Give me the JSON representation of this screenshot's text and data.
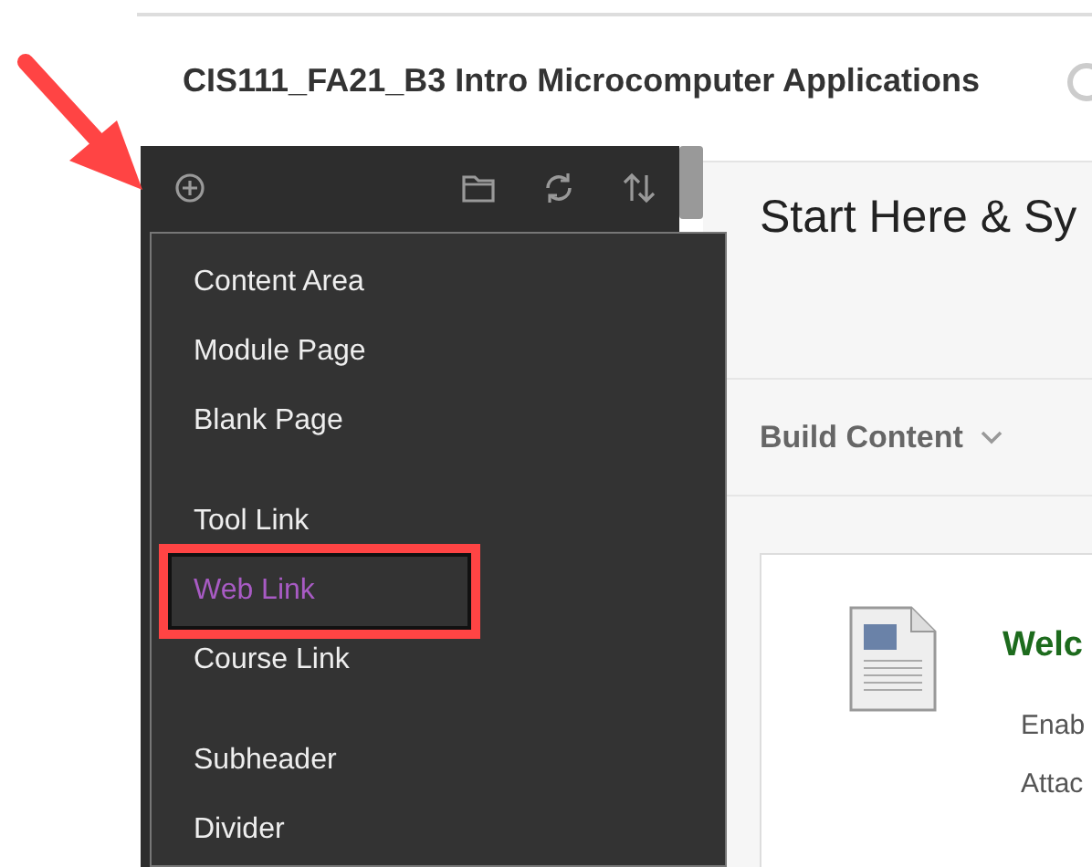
{
  "course_title": "CIS111_FA21_B3 Intro Microcomputer Applications",
  "menu": {
    "groups": [
      [
        {
          "label": "Content Area",
          "selected": false,
          "highlighted": false
        },
        {
          "label": "Module Page",
          "selected": false,
          "highlighted": false
        },
        {
          "label": "Blank Page",
          "selected": false,
          "highlighted": false
        }
      ],
      [
        {
          "label": "Tool Link",
          "selected": false,
          "highlighted": false
        },
        {
          "label": "Web Link",
          "selected": true,
          "highlighted": true
        },
        {
          "label": "Course Link",
          "selected": false,
          "highlighted": false
        }
      ],
      [
        {
          "label": "Subheader",
          "selected": false,
          "highlighted": false
        },
        {
          "label": "Divider",
          "selected": false,
          "highlighted": false
        }
      ]
    ]
  },
  "content": {
    "heading": "Start Here & Sy",
    "build_content": "Build Content",
    "item": {
      "title": "Welc",
      "lines": [
        "Enab",
        "Attac"
      ]
    }
  }
}
